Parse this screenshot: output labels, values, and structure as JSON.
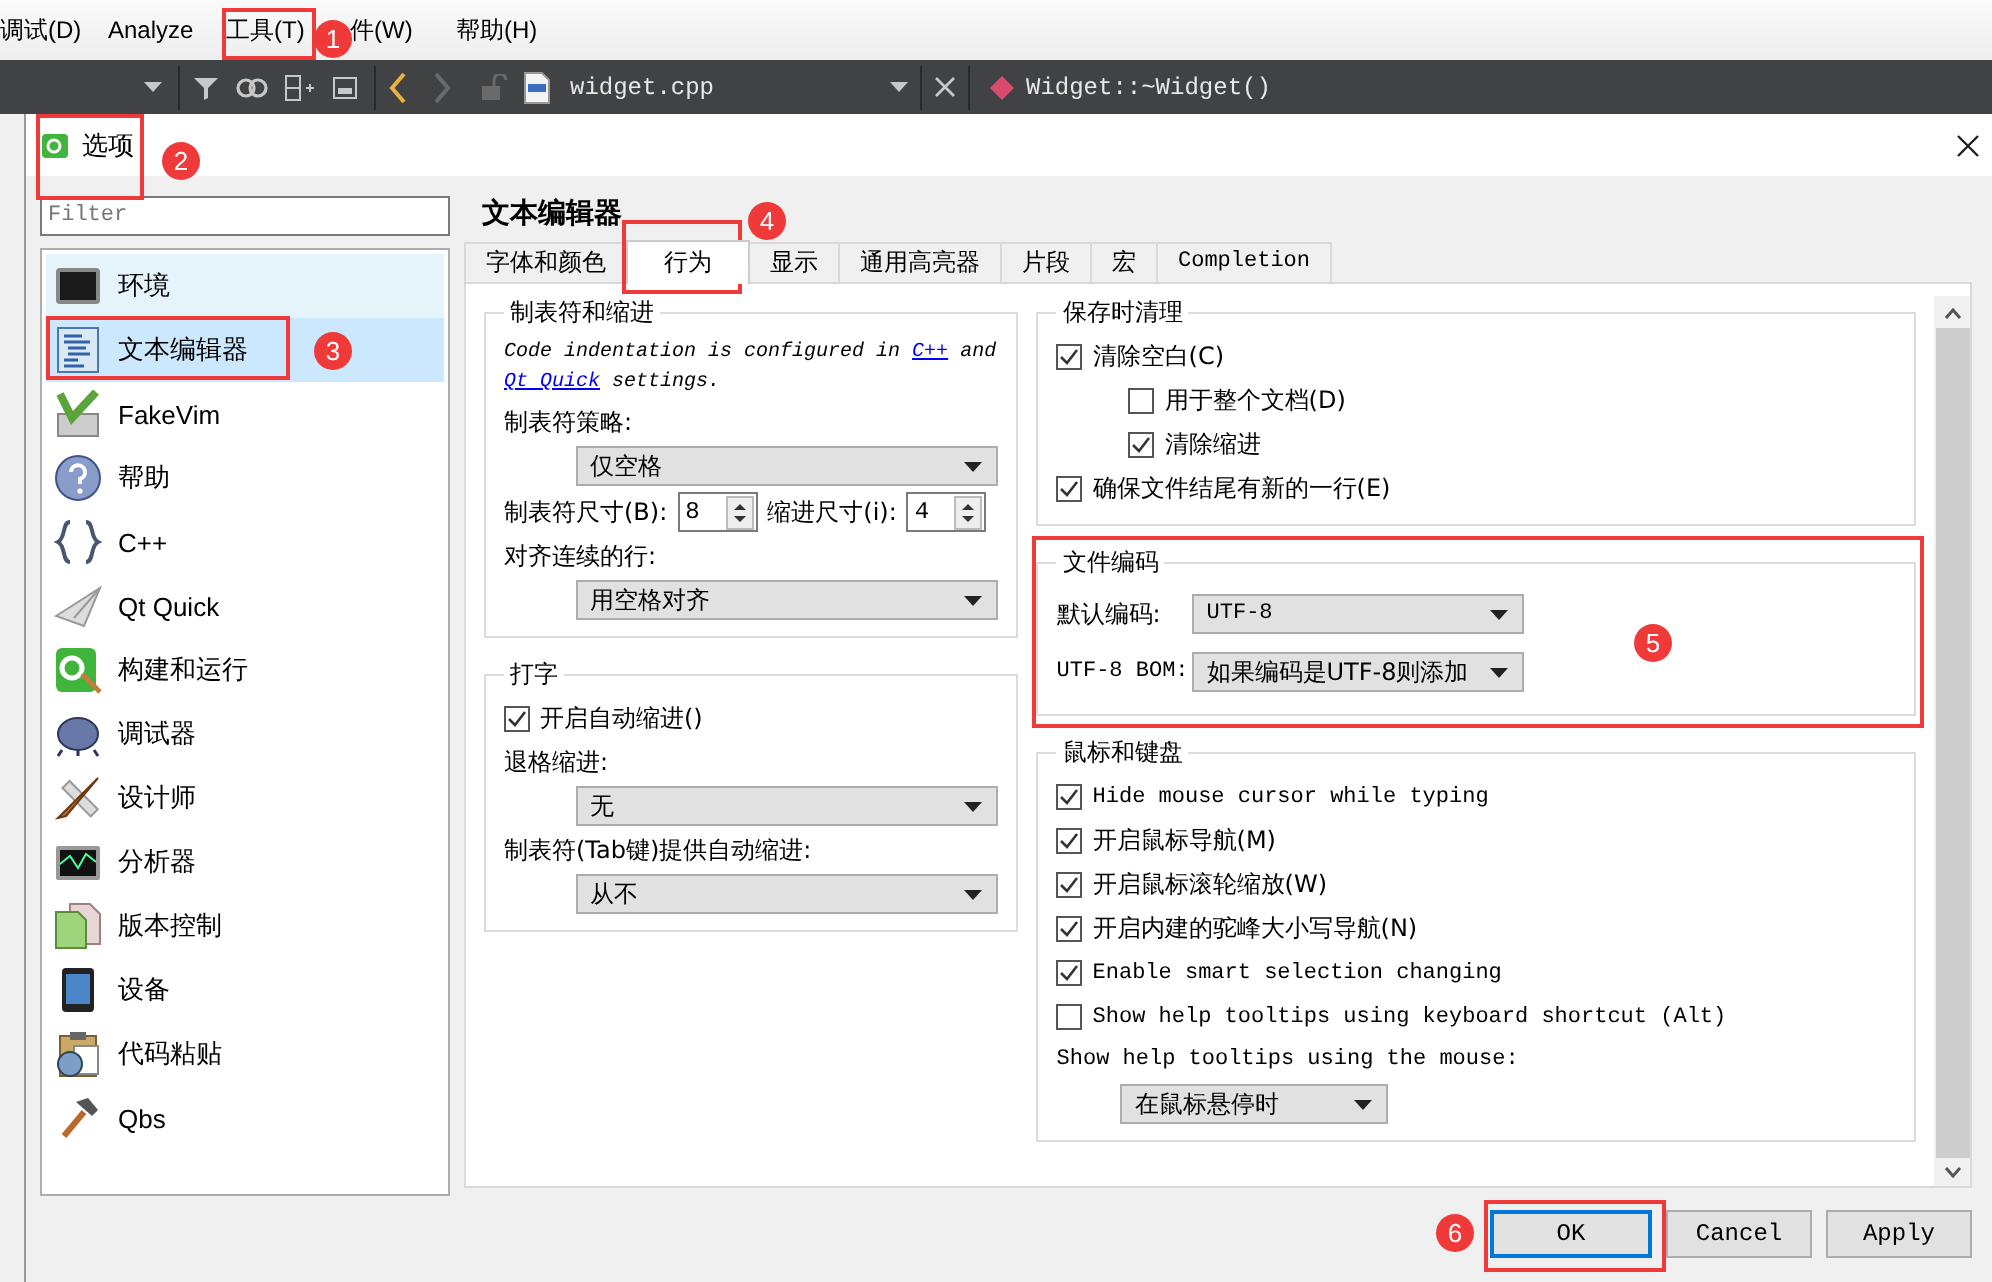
{
  "menu_bar": {
    "items": [
      {
        "label": "调试(D)"
      },
      {
        "label": "Analyze"
      },
      {
        "label": "工具(T)"
      },
      {
        "label": "件(W)"
      },
      {
        "label": "帮助(H)"
      }
    ]
  },
  "editor_toolbar": {
    "file": "widget.cpp",
    "symbol": "Widget::~Widget()"
  },
  "dialog": {
    "title": "选项",
    "filter": {
      "placeholder": "Filter"
    },
    "nav": {
      "items": [
        {
          "label": "环境",
          "selected": false,
          "hovered": true
        },
        {
          "label": "文本编辑器",
          "selected": true,
          "hovered": false
        },
        {
          "label": "FakeVim",
          "selected": false,
          "hovered": false
        },
        {
          "label": "帮助",
          "selected": false,
          "hovered": false
        },
        {
          "label": "C++",
          "selected": false,
          "hovered": false
        },
        {
          "label": "Qt Quick",
          "selected": false,
          "hovered": false
        },
        {
          "label": "构建和运行",
          "selected": false,
          "hovered": false
        },
        {
          "label": "调试器",
          "selected": false,
          "hovered": false
        },
        {
          "label": "设计师",
          "selected": false,
          "hovered": false
        },
        {
          "label": "分析器",
          "selected": false,
          "hovered": false
        },
        {
          "label": "版本控制",
          "selected": false,
          "hovered": false
        },
        {
          "label": "设备",
          "selected": false,
          "hovered": false
        },
        {
          "label": "代码粘贴",
          "selected": false,
          "hovered": false
        },
        {
          "label": "Qbs",
          "selected": false,
          "hovered": false
        }
      ]
    },
    "heading": "文本编辑器",
    "tabs": [
      {
        "label": "字体和颜色",
        "selected": false
      },
      {
        "label": "行为",
        "selected": true
      },
      {
        "label": "显示",
        "selected": false
      },
      {
        "label": "通用高亮器",
        "selected": false
      },
      {
        "label": "片段",
        "selected": false
      },
      {
        "label": "宏",
        "selected": false
      },
      {
        "label": "Completion",
        "selected": false
      }
    ],
    "columns": [
      {
        "groups": [
          {
            "title": "制表符和缩进",
            "rows": [
              {
                "kind": "note",
                "parts": [
                  {
                    "text": "Code indentation is configured in ",
                    "link": false
                  },
                  {
                    "text": "C++",
                    "link": true
                  },
                  {
                    "text": " and ",
                    "link": false
                  },
                  {
                    "text": "Qt Quick",
                    "link": true
                  },
                  {
                    "text": " settings.",
                    "link": false
                  }
                ]
              },
              {
                "kind": "label",
                "text": "制表符策略:"
              },
              {
                "kind": "combo",
                "value": "仅空格"
              },
              {
                "kind": "spins",
                "items": [
                  {
                    "label": "制表符尺寸(B):",
                    "value": "8"
                  },
                  {
                    "label": "缩进尺寸(i):",
                    "value": "4"
                  }
                ]
              },
              {
                "kind": "label",
                "text": "对齐连续的行:"
              },
              {
                "kind": "combo",
                "value": "用空格对齐"
              }
            ]
          },
          {
            "title": "打字",
            "rows": [
              {
                "kind": "check",
                "label": "开启自动缩进()",
                "checked": true
              },
              {
                "kind": "label",
                "text": "退格缩进:"
              },
              {
                "kind": "combo",
                "value": "无"
              },
              {
                "kind": "label",
                "text": "制表符(Tab键)提供自动缩进:"
              },
              {
                "kind": "combo",
                "value": "从不"
              }
            ]
          }
        ]
      },
      {
        "groups": [
          {
            "title": "保存时清理",
            "rows": [
              {
                "kind": "check",
                "label": "清除空白(C)",
                "checked": true,
                "children": [
                  {
                    "label": "用于整个文档(D)",
                    "checked": false
                  },
                  {
                    "label": "清除缩进",
                    "checked": true
                  }
                ]
              },
              {
                "kind": "check",
                "label": "确保文件结尾有新的一行(E)",
                "checked": true
              }
            ]
          },
          {
            "title": "文件编码",
            "rows": [
              {
                "kind": "labeled_combo",
                "label": "默认编码:",
                "value": "UTF-8"
              },
              {
                "kind": "labeled_combo",
                "label": "UTF-8 BOM:",
                "value": "如果编码是UTF-8则添加"
              }
            ]
          },
          {
            "title": "鼠标和键盘",
            "rows": [
              {
                "kind": "check",
                "label": "Hide mouse cursor while typing",
                "checked": true
              },
              {
                "kind": "check",
                "label": "开启鼠标导航(M)",
                "checked": true
              },
              {
                "kind": "check",
                "label": "开启鼠标滚轮缩放(W)",
                "checked": true
              },
              {
                "kind": "check",
                "label": "开启内建的驼峰大小写导航(N)",
                "checked": true
              },
              {
                "kind": "check",
                "label": "Enable smart selection changing",
                "checked": true
              },
              {
                "kind": "check",
                "label": "Show help tooltips using keyboard shortcut (Alt)",
                "checked": false
              },
              {
                "kind": "label",
                "text": "Show help tooltips using the mouse:"
              },
              {
                "kind": "combo",
                "value": "在鼠标悬停时"
              }
            ]
          }
        ]
      }
    ],
    "buttons": [
      {
        "label": "OK",
        "focused": true
      },
      {
        "label": "Cancel",
        "focused": false
      },
      {
        "label": "Apply",
        "focused": false
      }
    ]
  },
  "annotations": [
    {
      "number": "1"
    },
    {
      "number": "2"
    },
    {
      "number": "3"
    },
    {
      "number": "4"
    },
    {
      "number": "5"
    },
    {
      "number": "6"
    }
  ]
}
